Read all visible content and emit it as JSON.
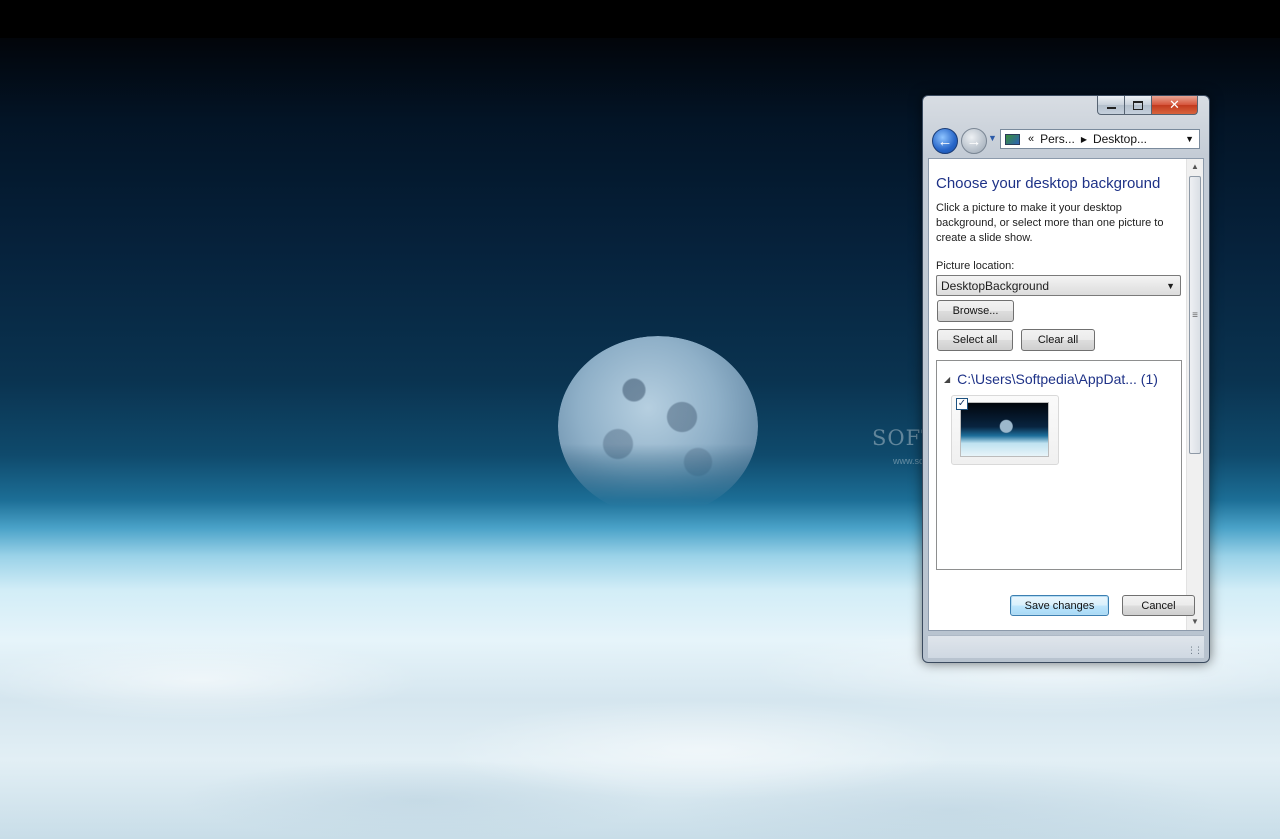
{
  "window": {
    "address": {
      "overflow": "«",
      "segments": [
        "Pers...",
        "Desktop..."
      ]
    },
    "heading": "Choose your desktop background",
    "description": "Click a picture to make it your desktop background, or select more than one picture to create a slide show.",
    "picture_location_label": "Picture location:",
    "picture_location_value": "DesktopBackground",
    "browse_label": "Browse...",
    "select_all_label": "Select all",
    "clear_all_label": "Clear all",
    "group": {
      "title": "C:\\Users\\Softpedia\\AppDat... (1)",
      "thumbnail_checked": "✓"
    },
    "save_label": "Save changes",
    "cancel_label": "Cancel",
    "caption": {
      "close_glyph": "✕"
    }
  },
  "watermark": {
    "brand": "SOFTPEDIA",
    "url": "www.softpedia.com"
  },
  "colors": {
    "heading": "#1e3287",
    "accent_button": "#3c7fb1",
    "close_button": "#c23a1f"
  },
  "icons": {
    "back": "back-arrow-icon",
    "forward": "forward-arrow-icon",
    "address": "control-panel-icon"
  }
}
